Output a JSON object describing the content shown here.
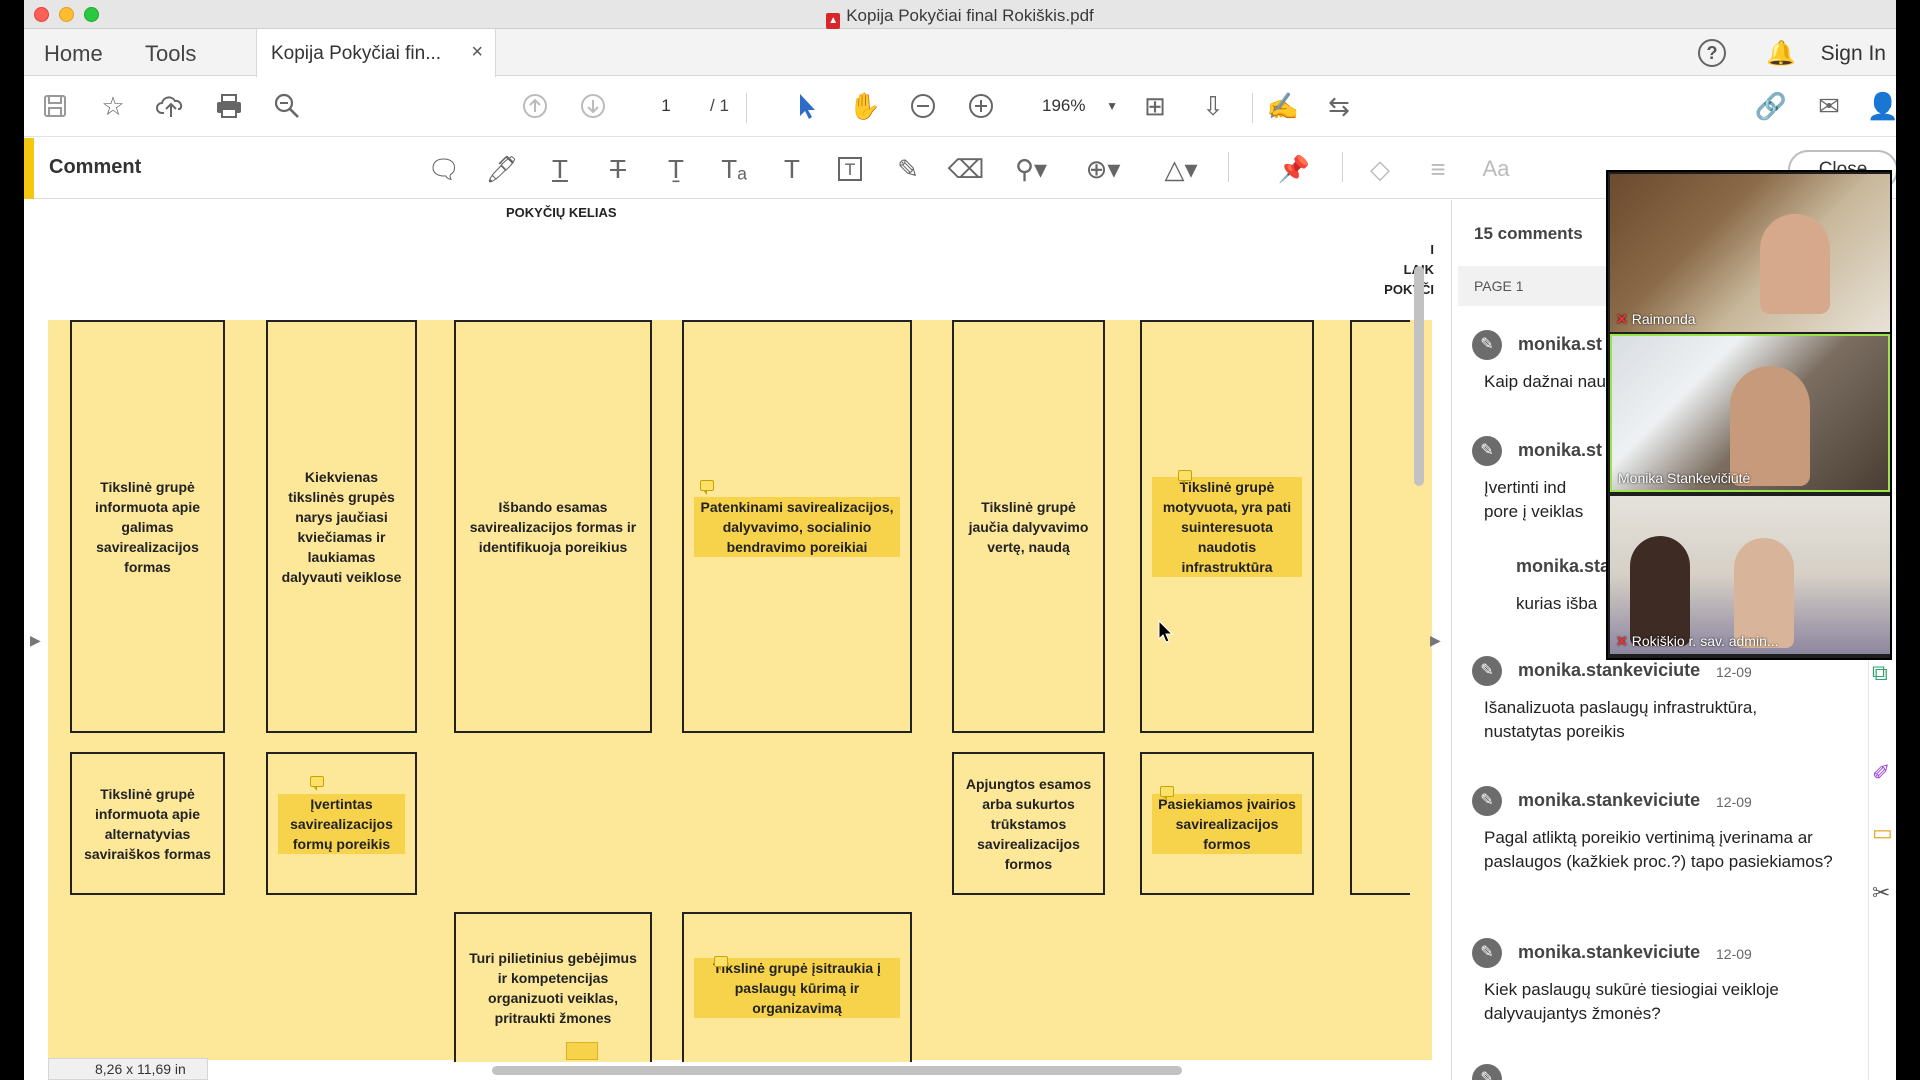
{
  "window": {
    "title": "Kopija Pokyčiai final Rokiškis.pdf"
  },
  "tabs": {
    "home": "Home",
    "tools": "Tools",
    "doc_tab": "Kopija Pokyčiai fin...",
    "close": "×",
    "sign_in": "Sign In"
  },
  "toolbar": {
    "page_current": "1",
    "page_total": "/ 1",
    "zoom": "196%"
  },
  "comment_bar": {
    "title": "Comment",
    "close": "Close"
  },
  "document": {
    "heading": "POKYČIŲ KELIAS",
    "right_cut_header": [
      "I",
      "LAIK",
      "POKYČI"
    ],
    "page_size": "8,26 x 11,69 in",
    "boxes": [
      "Tikslinė grupė informuota apie galimas savirealizacijos formas",
      "Kiekvienas tikslinės grupės narys jaučiasi kviečiamas ir laukiamas dalyvauti veiklose",
      "Išbando esamas savirealizacijos formas ir identifikuoja poreikius",
      "Patenkinami savirealizacijos, dalyvavimo, socialinio bendravimo poreikiai",
      "Tikslinė grupė jaučia dalyvavimo vertę, naudą",
      "Tikslinė grupė motyvuota, yra pati suinteresuota naudotis infrastruktūra",
      "Tikslinė grupė informuota apie alternatyvias saviraiškos formas",
      "Įvertintas savirealizacijos formų poreikis",
      "Apjungtos esamos arba sukurtos trūkstamos savirealizacijos formos",
      "Pasiekiamos įvairios savirealizacijos formos",
      "Turi pilietinius gebėjimus ir kompetencijas organizuoti veiklas, pritraukti žmones",
      "Tikslinė grupė įsitraukia į paslaugų kūrimą ir organizavimą"
    ]
  },
  "comments_panel": {
    "count": "15 comments",
    "page_header": "PAGE 1",
    "items": [
      {
        "author": "monika.st",
        "date": "",
        "body": "Kaip dažnai nau"
      },
      {
        "author": "monika.st",
        "date": "",
        "body": "Įvertinti ind pore į veiklas"
      },
      {
        "author": "monika.sta",
        "date": "",
        "body": "kurias išba"
      },
      {
        "author": "monika.stankeviciute",
        "date": "12-09",
        "body": "Išanalizuota paslaugų infrastruktūra, nustatytas poreikis"
      },
      {
        "author": "monika.stankeviciute",
        "date": "12-09",
        "body": "Pagal atliktą poreikio vertinimą įverinama ar paslaugos (kažkiek proc.?) tapo pasiekiamos?"
      },
      {
        "author": "monika.stankeviciute",
        "date": "12-09",
        "body": "Kiek paslaugų sukūrė tiesiogiai veikloje dalyvaujantys žmonės?"
      }
    ]
  },
  "video_call": {
    "participants": [
      "Raimonda",
      "Monika Stankevičiūtė",
      "Rokiškio r. sav. admin..."
    ]
  },
  "colors": {
    "accent": "#f2c811",
    "doc_yellow": "#fde89a",
    "highlight": "#f7d34c"
  }
}
